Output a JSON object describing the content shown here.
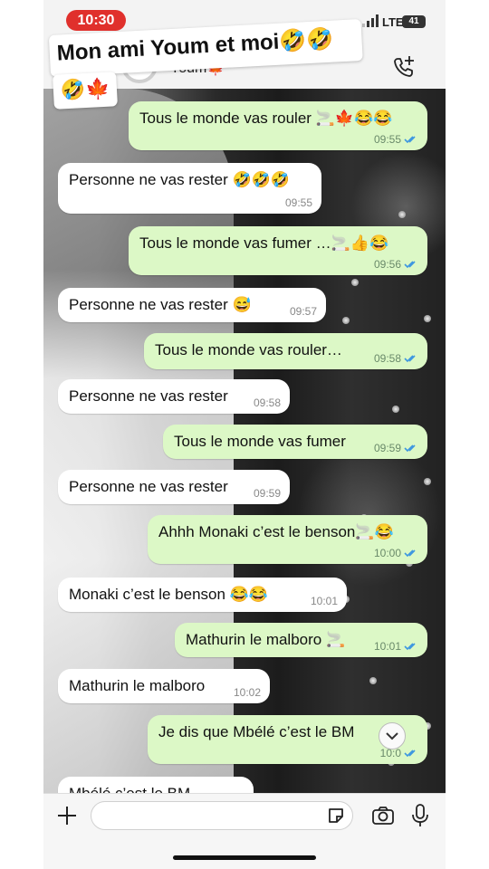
{
  "status_bar": {
    "time": "10:30",
    "network": "LTE",
    "battery": "41"
  },
  "caption": {
    "line1": "Mon ami  Youm et moi🤣🤣",
    "line2": "🤣🍁"
  },
  "header": {
    "contact_name": "Youm🍁"
  },
  "composer": {
    "placeholder": ""
  },
  "messages": [
    {
      "dir": "out",
      "text": "Tous le monde vas rouler 🚬🍁😂😂",
      "time": "09:55",
      "read": true
    },
    {
      "dir": "in",
      "text": "Personne ne vas rester 🤣🤣🤣",
      "time": "09:55"
    },
    {
      "dir": "out",
      "text": "Tous le monde vas fumer …🚬👍😂",
      "time": "09:56",
      "read": true
    },
    {
      "dir": "in",
      "text": "Personne ne vas rester 😅",
      "time": "09:57"
    },
    {
      "dir": "out",
      "text": "Tous le monde vas rouler…",
      "time": "09:58",
      "read": true
    },
    {
      "dir": "in",
      "text": "Personne ne vas rester",
      "time": "09:58"
    },
    {
      "dir": "out",
      "text": "Tous le monde vas fumer",
      "time": "09:59",
      "read": true
    },
    {
      "dir": "in",
      "text": "Personne ne vas rester",
      "time": "09:59"
    },
    {
      "dir": "out",
      "text": "Ahhh Monaki c’est le benson🚬😂",
      "time": "10:00",
      "read": true
    },
    {
      "dir": "in",
      "text": "Monaki c’est le benson 😂😂",
      "time": "10:01"
    },
    {
      "dir": "out",
      "text": "Mathurin le malboro 🚬",
      "time": "10:01",
      "read": true
    },
    {
      "dir": "in",
      "text": "Mathurin le malboro",
      "time": "10:02"
    },
    {
      "dir": "out",
      "text": "Je dis que Mbélé c’est le BM",
      "time": "10:0",
      "read": true
    },
    {
      "dir": "in",
      "text": "Mbélé c’est le BM",
      "time": ""
    }
  ]
}
